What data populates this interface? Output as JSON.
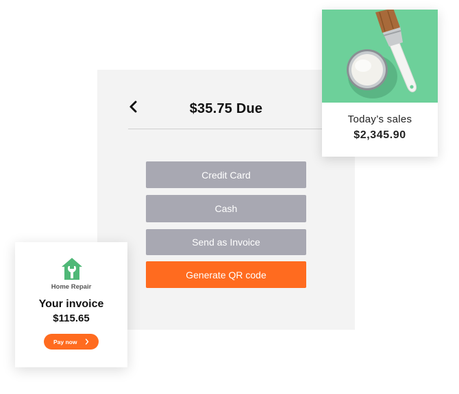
{
  "payment_panel": {
    "title": "$35.75 Due",
    "back_icon": "chevron-left-icon",
    "options": [
      {
        "label": "Credit Card",
        "color": "#a8a8b2"
      },
      {
        "label": "Cash",
        "color": "#a8a8b2"
      },
      {
        "label": "Send as Invoice",
        "color": "#a8a8b2"
      },
      {
        "label": "Generate QR code",
        "color": "#ff6b1f"
      }
    ]
  },
  "sales_card": {
    "image_icon": "paint-can-brush-image",
    "label": "Today’s sales",
    "value": "$2,345.90",
    "image_background": "#6dd09a"
  },
  "invoice_card": {
    "brand_logo_icon": "house-wrench-icon",
    "brand_name": "Home Repair",
    "title": "Your invoice",
    "amount": "$115.65",
    "pay_button_label": "Pay now",
    "pay_button_icon": "chevron-right-icon",
    "brand_color": "#4fb877"
  },
  "colors": {
    "accent": "#ff6b1f",
    "neutral_button": "#a8a8b2",
    "panel_background": "#f3f3f3"
  }
}
